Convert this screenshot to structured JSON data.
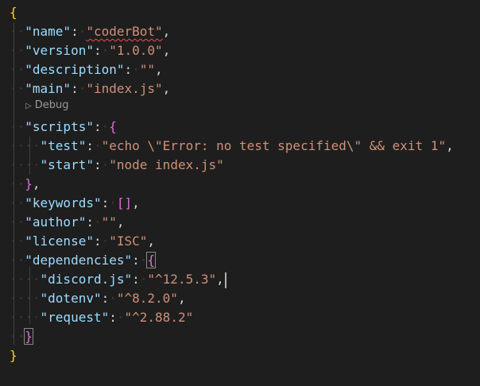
{
  "json": {
    "name_key": "\"name\"",
    "name_val": "\"coderBot\"",
    "version_key": "\"version\"",
    "version_val": "\"1.0.0\"",
    "description_key": "\"description\"",
    "description_val": "\"\"",
    "main_key": "\"main\"",
    "main_val": "\"index.js\"",
    "codelens_label": "Debug",
    "scripts_key": "\"scripts\"",
    "test_key": "\"test\"",
    "test_val": "\"echo \\\"Error: no test specified\\\" && exit 1\"",
    "start_key": "\"start\"",
    "start_val": "\"node index.js\"",
    "keywords_key": "\"keywords\"",
    "author_key": "\"author\"",
    "author_val": "\"\"",
    "license_key": "\"license\"",
    "license_val": "\"ISC\"",
    "dependencies_key": "\"dependencies\"",
    "discord_key": "\"discord.js\"",
    "discord_val": "\"^12.5.3\"",
    "dotenv_key": "\"dotenv\"",
    "dotenv_val": "\"^8.2.0\"",
    "request_key": "\"request\"",
    "request_val": "\"^2.88.2\""
  },
  "colors": {
    "background": "#1e1e1e",
    "key": "#9cdcfe",
    "string": "#ce9178",
    "brace_level1": "#ffd700",
    "brace_level2": "#da70d6",
    "brace_level3": "#179fff"
  }
}
